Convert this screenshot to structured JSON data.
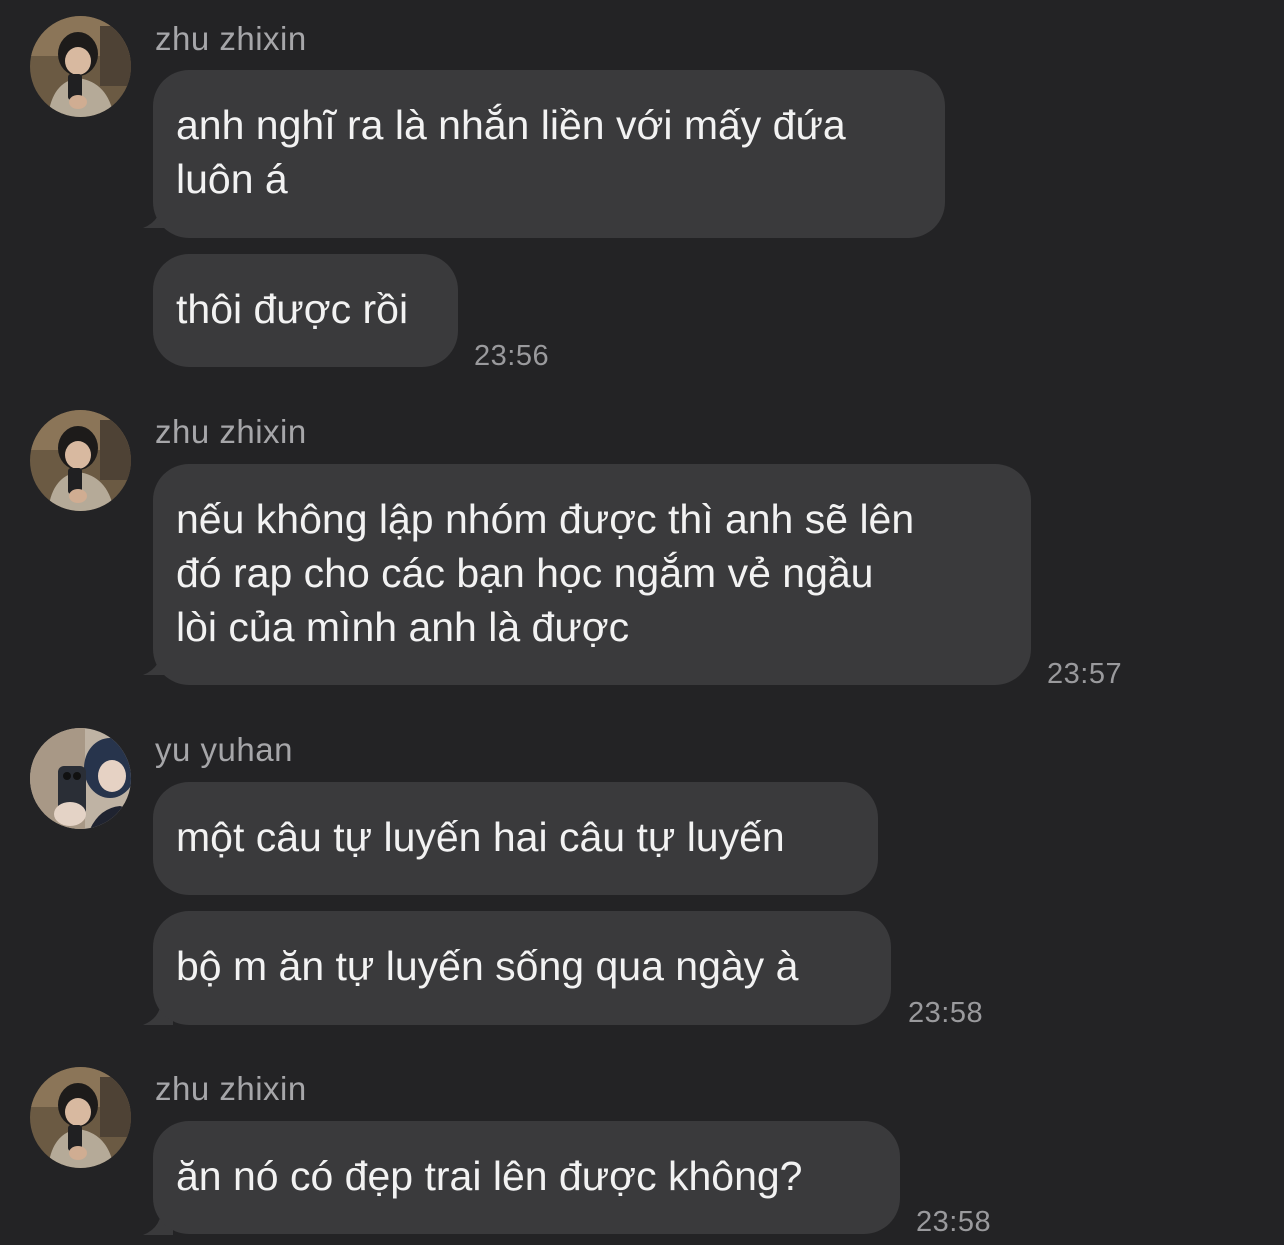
{
  "messages": [
    {
      "sender": "zhu zhixin",
      "avatar_icon": "avatar-photo",
      "bubbles": [
        {
          "lines": [
            "anh nghĩ ra là nhắn liền với mấy đứa",
            "luôn á"
          ]
        },
        {
          "lines": [
            "thôi được rồi"
          ],
          "time": "23:56"
        }
      ]
    },
    {
      "sender": "zhu zhixin",
      "avatar_icon": "avatar-photo",
      "bubbles": [
        {
          "lines": [
            "nếu không lập nhóm được thì anh sẽ lên",
            "đó rap cho các bạn học ngắm vẻ ngầu",
            "lòi của mình anh là được"
          ],
          "time": "23:57"
        }
      ]
    },
    {
      "sender": "yu yuhan",
      "avatar_icon": "avatar-photo",
      "bubbles": [
        {
          "lines": [
            "một câu tự luyến hai câu tự luyến"
          ]
        },
        {
          "lines": [
            "bộ m ăn tự luyến sống qua ngày à"
          ],
          "time": "23:58"
        }
      ]
    },
    {
      "sender": "zhu zhixin",
      "avatar_icon": "avatar-photo",
      "bubbles": [
        {
          "lines": [
            "ăn nó có đẹp trai lên được không?"
          ],
          "time": "23:58"
        }
      ]
    }
  ],
  "colors": {
    "background": "#232325",
    "bubble": "#3a3a3c",
    "text": "#f2f2f2",
    "meta": "#a6a6a9"
  }
}
